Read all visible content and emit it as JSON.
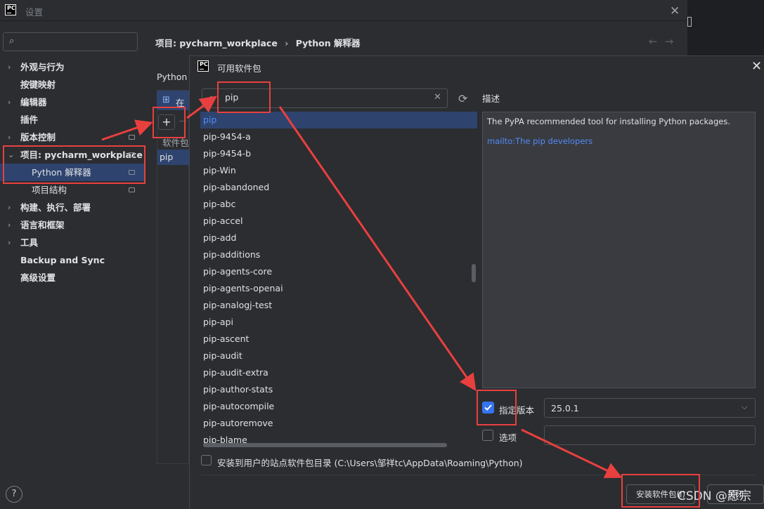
{
  "settings": {
    "title": "设置",
    "logo": "PC",
    "search_placeholder": "",
    "sidebar": [
      {
        "label": "外观与行为",
        "expandable": true
      },
      {
        "label": "按键映射",
        "expandable": false
      },
      {
        "label": "编辑器",
        "expandable": true
      },
      {
        "label": "插件",
        "expandable": false
      },
      {
        "label": "版本控制",
        "expandable": true,
        "pinned": true
      },
      {
        "label": "项目: pycharm_workplace",
        "expandable": true,
        "expanded": true,
        "pinned": true
      },
      {
        "label": "Python 解释器",
        "child": true,
        "selected": true,
        "pinned": true
      },
      {
        "label": "项目结构",
        "child": true,
        "pinned": true
      },
      {
        "label": "构建、执行、部署",
        "expandable": true
      },
      {
        "label": "语言和框架",
        "expandable": true
      },
      {
        "label": "工具",
        "expandable": true
      },
      {
        "label": "Backup and Sync",
        "expandable": false
      },
      {
        "label": "高级设置",
        "expandable": false
      }
    ],
    "help": "?",
    "breadcrumb": {
      "project": "项目: pycharm_workplace",
      "sep": "›",
      "page": "Python 解释器"
    },
    "interpreter_label": "Python 解",
    "tab_label": "在",
    "column_package": "软件包",
    "installed_row": "pip"
  },
  "dialog": {
    "logo": "PC",
    "title": "可用软件包",
    "search_value": "pip",
    "packages": [
      "pip",
      "pip-9454-a",
      "pip-9454-b",
      "pip-Win",
      "pip-abandoned",
      "pip-abc",
      "pip-accel",
      "pip-add",
      "pip-additions",
      "pip-agents-core",
      "pip-agents-openai",
      "pip-analogj-test",
      "pip-api",
      "pip-ascent",
      "pip-audit",
      "pip-audit-extra",
      "pip-author-stats",
      "pip-autocompile",
      "pip-autoremove",
      "pip-blame"
    ],
    "selected_package": "pip",
    "description_label": "描述",
    "description": "The PyPA recommended tool for installing Python packages.",
    "description_link": "mailto:The pip developers",
    "specify_version": {
      "label": "指定版本",
      "checked": true,
      "value": "25.0.1"
    },
    "options": {
      "label": "选项",
      "checked": false,
      "value": ""
    },
    "user_site": {
      "label": "安装到用户的站点软件包目录 (C:\\Users\\邹祥tc\\AppData\\Roaming\\Python)",
      "checked": false
    },
    "install_button": "安装软件包(I)",
    "close_button": "关闭"
  },
  "watermark": "CSDN @愿宗",
  "colors": {
    "accent": "#3574f0",
    "selection": "#2e436e",
    "annotation": "#e8403f",
    "link": "#548af7"
  }
}
